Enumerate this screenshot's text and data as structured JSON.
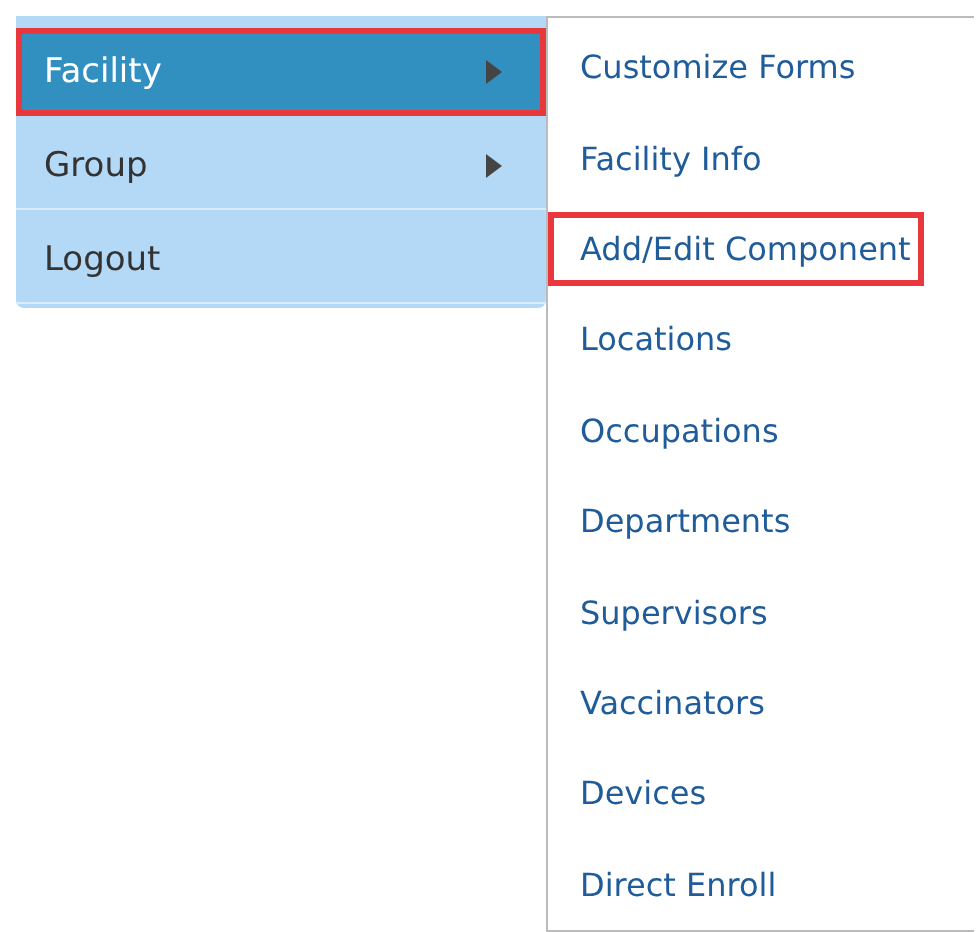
{
  "menu": {
    "items": [
      {
        "label": "Facility",
        "selected": true,
        "highlighted": true,
        "has_submenu": true
      },
      {
        "label": "Group",
        "selected": false,
        "highlighted": false,
        "has_submenu": true
      },
      {
        "label": "Logout",
        "selected": false,
        "highlighted": false,
        "has_submenu": false
      }
    ]
  },
  "submenu": {
    "items": [
      {
        "label": "Customize Forms",
        "highlighted": false
      },
      {
        "label": "Facility Info",
        "highlighted": false
      },
      {
        "label": "Add/Edit Component",
        "highlighted": true
      },
      {
        "label": "Locations",
        "highlighted": false
      },
      {
        "label": "Occupations",
        "highlighted": false
      },
      {
        "label": "Departments",
        "highlighted": false
      },
      {
        "label": "Supervisors",
        "highlighted": false
      },
      {
        "label": "Vaccinators",
        "highlighted": false
      },
      {
        "label": "Devices",
        "highlighted": false
      },
      {
        "label": "Direct Enroll",
        "highlighted": false
      }
    ]
  }
}
